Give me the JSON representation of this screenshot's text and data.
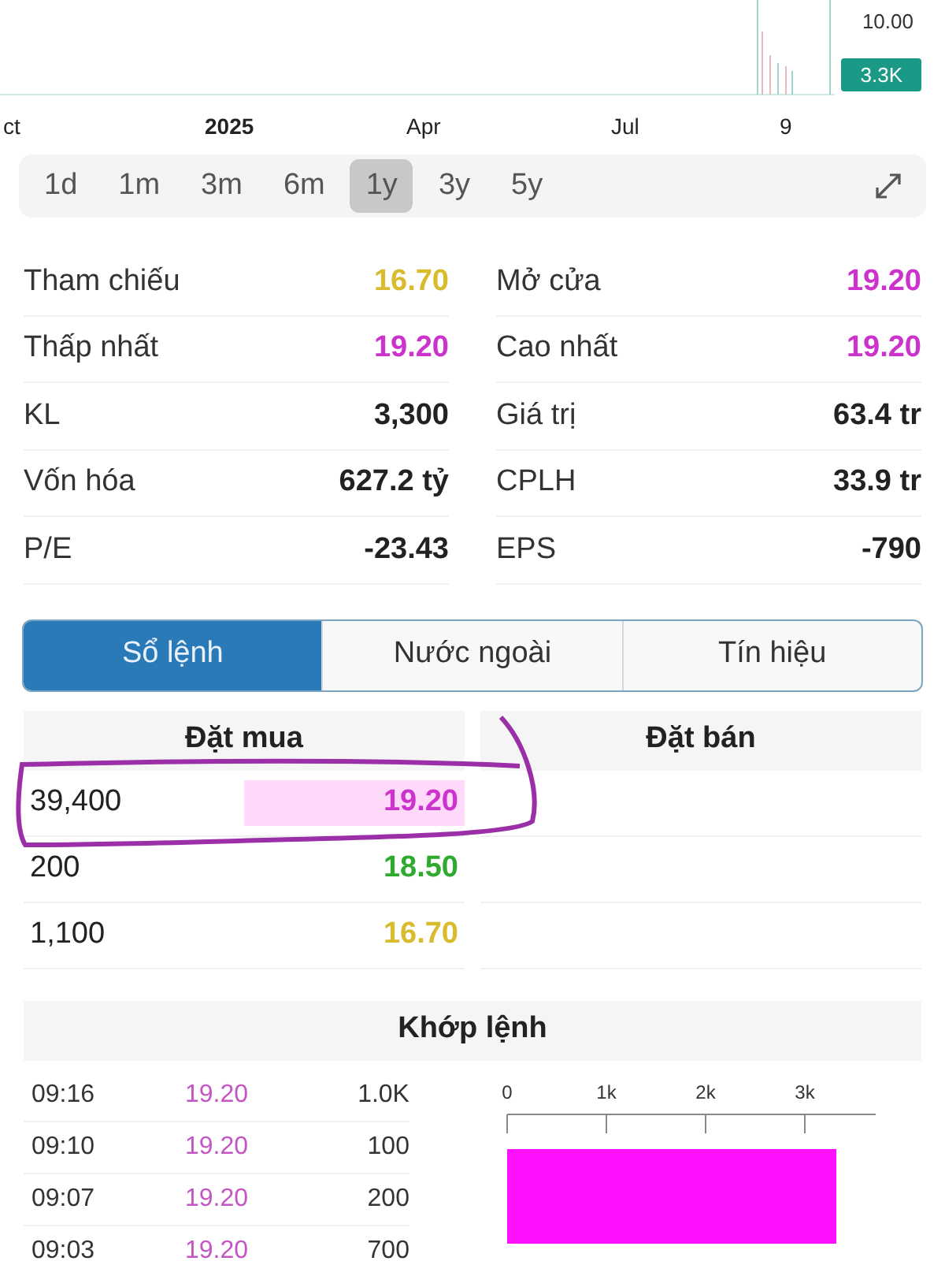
{
  "price_chart": {
    "price_label": "10.00",
    "volume_badge": "3.3K",
    "x_labels": [
      {
        "label": "ct",
        "bold": false
      },
      {
        "label": "2025",
        "bold": true
      },
      {
        "label": "Apr",
        "bold": false
      },
      {
        "label": "Jul",
        "bold": false
      },
      {
        "label": "9",
        "bold": false
      }
    ]
  },
  "periods": [
    {
      "label": "1d",
      "selected": false
    },
    {
      "label": "1m",
      "selected": false
    },
    {
      "label": "3m",
      "selected": false
    },
    {
      "label": "6m",
      "selected": false
    },
    {
      "label": "1y",
      "selected": true
    },
    {
      "label": "3y",
      "selected": false
    },
    {
      "label": "5y",
      "selected": false
    }
  ],
  "stats": [
    {
      "label": "Tham chiếu",
      "value": "16.70",
      "color": "#d9bb2e"
    },
    {
      "label": "Mở cửa",
      "value": "19.20",
      "color": "#cc33cc"
    },
    {
      "label": "Thấp nhất",
      "value": "19.20",
      "color": "#cc33cc"
    },
    {
      "label": "Cao nhất",
      "value": "19.20",
      "color": "#cc33cc"
    },
    {
      "label": "KL",
      "value": "3,300",
      "color": "#222222"
    },
    {
      "label": "Giá trị",
      "value": "63.4 tr",
      "color": "#222222"
    },
    {
      "label": "Vốn hóa",
      "value": "627.2 tỷ",
      "color": "#222222"
    },
    {
      "label": "CPLH",
      "value": "33.9 tr",
      "color": "#222222"
    },
    {
      "label": "P/E",
      "value": "-23.43",
      "color": "#222222"
    },
    {
      "label": "EPS",
      "value": "-790",
      "color": "#222222"
    }
  ],
  "tabs": [
    {
      "label": "Sổ lệnh",
      "selected": true
    },
    {
      "label": "Nước ngoài",
      "selected": false
    },
    {
      "label": "Tín hiệu",
      "selected": false
    }
  ],
  "order_book": {
    "columns": [
      "Đặt mua",
      "Đặt bán"
    ],
    "bids": [
      {
        "volume": "39,400",
        "price": "19.20",
        "color": "#cc33cc",
        "level": 0.5
      },
      {
        "volume": "200",
        "price": "18.50",
        "color": "#2eaa2e"
      },
      {
        "volume": "1,100",
        "price": "16.70",
        "color": "#d9bb2e"
      }
    ]
  },
  "matches": {
    "title": "Khớp lệnh",
    "rows": [
      {
        "time": "09:16",
        "price": "19.20",
        "volume": "1.0K"
      },
      {
        "time": "09:10",
        "price": "19.20",
        "volume": "100"
      },
      {
        "time": "09:07",
        "price": "19.20",
        "volume": "200"
      },
      {
        "time": "09:03",
        "price": "19.20",
        "volume": "700"
      }
    ],
    "volume_chart": {
      "tick_labels": [
        "0",
        "1k",
        "2k",
        "3k"
      ]
    }
  }
}
